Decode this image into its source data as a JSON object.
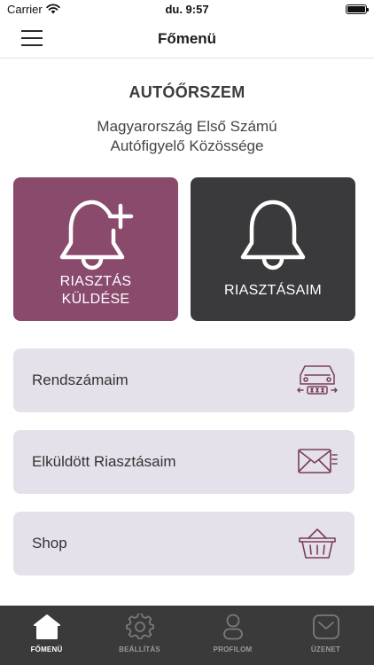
{
  "status_bar": {
    "carrier": "Carrier",
    "time": "du. 9:57",
    "battery_level": 1.0
  },
  "nav": {
    "title": "Főmenü"
  },
  "brand": {
    "name": "AUTÓŐRSZEM",
    "tagline_line1": "Magyarország Első Számú",
    "tagline_line2": "Autófigyelő Közössége"
  },
  "tiles": {
    "send_line1": "RIASZTÁS",
    "send_line2": "KÜLDÉSE",
    "mine": "RIASZTÁSAIM"
  },
  "menu": {
    "plates": "Rendszámaim",
    "sent": "Elküldött Riasztásaim",
    "shop": "Shop"
  },
  "tabs": {
    "home": "FŐMENÜ",
    "settings": "BEÁLLÍTÁS",
    "profile": "PROFILOM",
    "messages": "ÜZENET"
  },
  "colors": {
    "accent": "#8a4a6c",
    "dark_tile": "#3a3a3c",
    "row_bg": "#e4e1ea",
    "tab_bar": "#3a3a3a",
    "icon": "#7a3d5e"
  },
  "icons": {
    "menu": "hamburger-icon",
    "send_alarm": "bell-plus-icon",
    "my_alarms": "bell-icon",
    "plates": "car-plate-icon",
    "sent": "envelope-icon",
    "shop": "basket-icon",
    "tab_home": "home-icon",
    "tab_settings": "gear-icon",
    "tab_profile": "user-icon",
    "tab_messages": "message-icon"
  }
}
